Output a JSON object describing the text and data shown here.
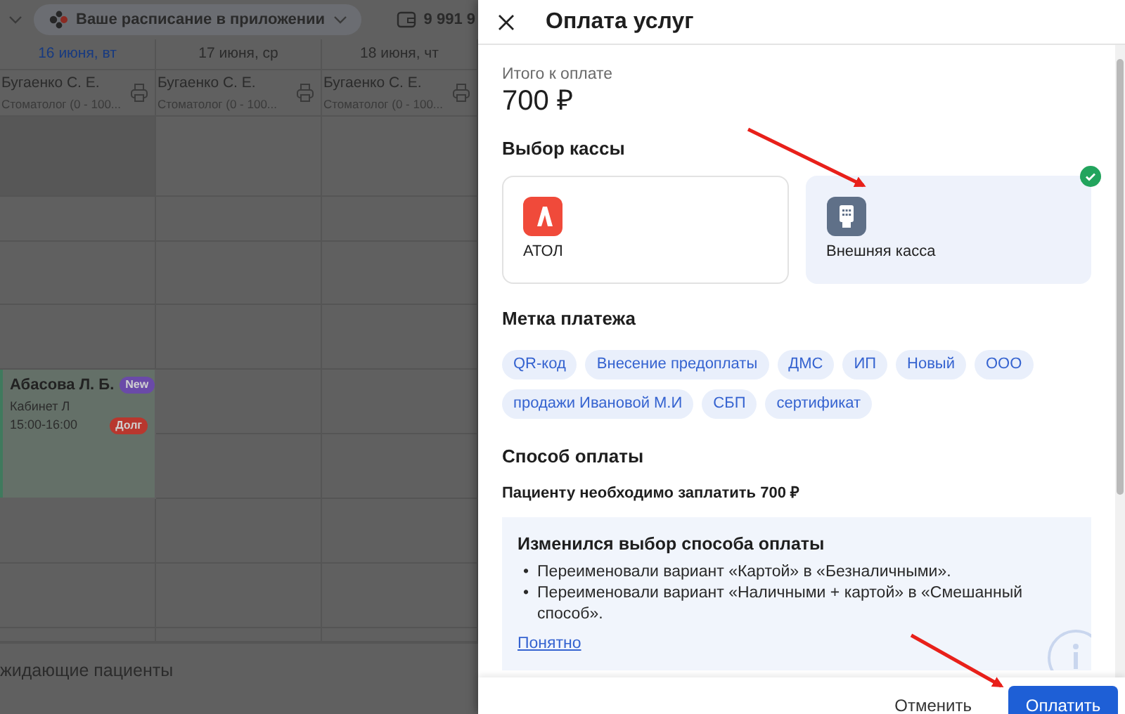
{
  "background": {
    "toolbar": {
      "schedule_menu": "Ваше расписание в приложении",
      "balance": "9 991 9"
    },
    "calendar": {
      "days": [
        {
          "label": "16 июня, вт",
          "selected": true
        },
        {
          "label": "17 июня, ср",
          "selected": false
        },
        {
          "label": "18 июня, чт",
          "selected": false
        }
      ],
      "doctors": [
        {
          "name": "Бугаенко С. Е.",
          "specialty": "Стоматолог (0 - 100..."
        },
        {
          "name": "Бугаенко С. Е.",
          "specialty": "Стоматолог (0 - 100..."
        },
        {
          "name": "Бугаенко С. Е.",
          "specialty": "Стоматолог (0 - 100..."
        }
      ],
      "appointments": [
        {
          "patient": "Абасова Л. Б.",
          "room": "Кабинет Л",
          "time": "15:00-16:00",
          "badges": [
            {
              "text": "New",
              "color": "#6a4aa8"
            },
            {
              "text": "Долг",
              "color": "#b8372e"
            }
          ]
        }
      ]
    },
    "waiting_section": "жидающие пациенты"
  },
  "drawer": {
    "title": "Оплата услуг",
    "total_label": "Итого к оплате",
    "total": "700 ₽",
    "register_heading": "Выбор кассы",
    "registers": [
      {
        "name": "АТОЛ",
        "kind": "atol",
        "selected": false
      },
      {
        "name": "Внешняя касса",
        "kind": "external",
        "selected": true
      }
    ],
    "tag_heading": "Метка платежа",
    "tags": [
      "QR-код",
      "Внесение предоплаты",
      "ДМС",
      "ИП",
      "Новый",
      "ООО",
      "продажи Ивановой М.И",
      "СБП",
      "сертификат"
    ],
    "method_heading": "Способ оплаты",
    "amount_note": "Пациенту необходимо заплатить 700 ₽",
    "notice": {
      "title": "Изменился выбор способа оплаты",
      "bullet": "•",
      "items": [
        "Переименовали вариант «Картой» в «Безналичными».",
        "Переименовали вариант «Наличными + картой» в «Смешанный способ»."
      ],
      "link": "Понятно"
    },
    "buttons": [
      {
        "label": "Отменить",
        "kind": "secondary"
      },
      {
        "label": "Оплатить",
        "kind": "primary"
      }
    ]
  }
}
